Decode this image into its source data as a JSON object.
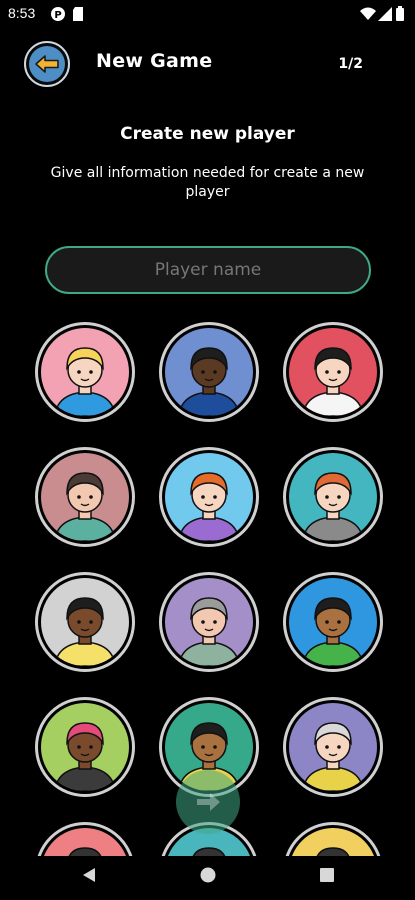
{
  "status_bar": {
    "time": "8:53",
    "left_icons": [
      "app-notification-icon",
      "sim-card-icon"
    ],
    "right_icons": [
      "wifi-icon",
      "cellular-signal-icon",
      "battery-icon"
    ]
  },
  "app_bar": {
    "back_icon": "arrow-left-icon",
    "title": "New Game",
    "step": "1/2"
  },
  "form": {
    "heading": "Create new player",
    "description": "Give all information needed for create a new player",
    "name_input": {
      "value": "",
      "placeholder": "Player name"
    }
  },
  "avatars": [
    {
      "name": "blonde-girl",
      "bg": "#f3a2b4"
    },
    {
      "name": "beard-man-gold-chain",
      "bg": "#6f8fd0"
    },
    {
      "name": "black-bob-hair",
      "bg": "#e2515f"
    },
    {
      "name": "glasses-quiff-man",
      "bg": "#c98c8f"
    },
    {
      "name": "ginger-curly-girl",
      "bg": "#72c9ee"
    },
    {
      "name": "ginger-beard-man",
      "bg": "#43b6bf"
    },
    {
      "name": "dark-hair-woman",
      "bg": "#d2d2d2"
    },
    {
      "name": "grey-hair-glasses-man",
      "bg": "#a58fc8"
    },
    {
      "name": "bun-hair-woman",
      "bg": "#2e97e0"
    },
    {
      "name": "mohawk-man",
      "bg": "#a5d061"
    },
    {
      "name": "headband-girl",
      "bg": "#35a989"
    },
    {
      "name": "grandma-glasses",
      "bg": "#8d86c6"
    },
    {
      "name": "partial-avatar-pink",
      "bg": "#ee7f82"
    },
    {
      "name": "partial-avatar-teal",
      "bg": "#49b6bd"
    },
    {
      "name": "partial-avatar-yellow",
      "bg": "#f2d060"
    }
  ],
  "next_button": {
    "icon": "arrow-right-icon"
  },
  "nav_bar": {
    "icons": [
      "back-triangle-icon",
      "home-circle-icon",
      "recents-square-icon"
    ]
  },
  "colors": {
    "accent_green": "#3fa985",
    "back_button_blue": "#4d8ec6",
    "back_arrow_yellow": "#f2b233"
  }
}
